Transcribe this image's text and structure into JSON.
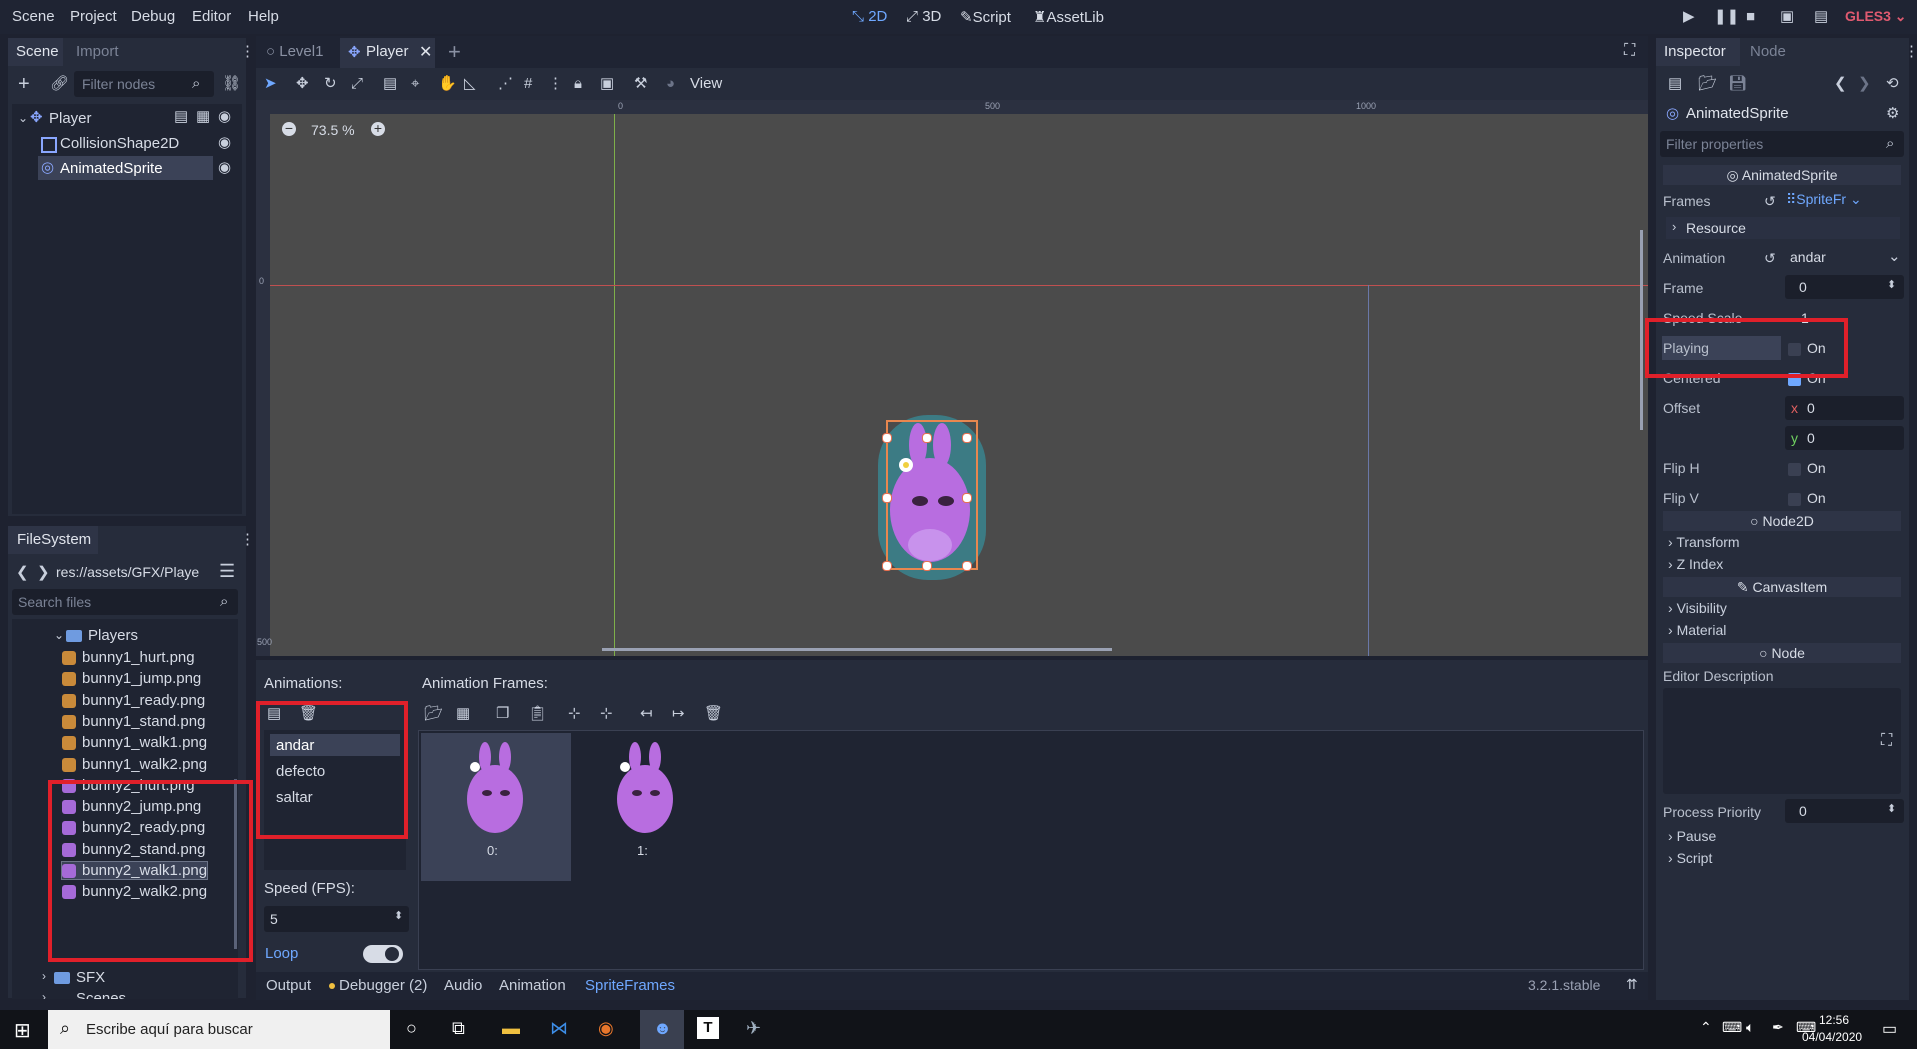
{
  "menu": {
    "scene": "Scene",
    "project": "Project",
    "debug": "Debug",
    "editor": "Editor",
    "help": "Help"
  },
  "modes": {
    "m2d": "2D",
    "m3d": "3D",
    "script": "Script",
    "assetlib": "AssetLib"
  },
  "renderer": "GLES3",
  "left_dock": {
    "tabs": {
      "scene": "Scene",
      "import": "Import"
    },
    "filter_placeholder": "Filter nodes",
    "tree": [
      {
        "label": "Player"
      },
      {
        "label": "CollisionShape2D"
      },
      {
        "label": "AnimatedSprite"
      }
    ]
  },
  "filesystem": {
    "title": "FileSystem",
    "path": "res://assets/GFX/Playe",
    "search_placeholder": "Search files",
    "folder": "Players",
    "files": [
      "bunny1_hurt.png",
      "bunny1_jump.png",
      "bunny1_ready.png",
      "bunny1_stand.png",
      "bunny1_walk1.png",
      "bunny1_walk2.png",
      "bunny2_hurt.png",
      "bunny2_jump.png",
      "bunny2_ready.png",
      "bunny2_stand.png",
      "bunny2_walk1.png",
      "bunny2_walk2.png"
    ],
    "sfx": "SFX",
    "scenes": "Scenes"
  },
  "editor_tabs": {
    "level1": "Level1",
    "player": "Player"
  },
  "toolbar": {
    "view": "View"
  },
  "viewport": {
    "zoom": "73.5 %",
    "ruler": {
      "r0": "0",
      "r500": "500",
      "r1000": "1000",
      "v0": "0",
      "v500": "500"
    }
  },
  "spriteframes": {
    "animations_title": "Animations:",
    "frames_title": "Animation Frames:",
    "animations": [
      "andar",
      "defecto",
      "saltar"
    ],
    "frames": [
      "0:",
      "1:"
    ],
    "speed_label": "Speed (FPS):",
    "speed_value": "5",
    "loop_label": "Loop"
  },
  "bottom_bar": {
    "output": "Output",
    "debugger": "Debugger (2)",
    "audio": "Audio",
    "animation": "Animation",
    "spriteframes": "SpriteFrames",
    "version": "3.2.1.stable"
  },
  "inspector": {
    "tabs": {
      "inspector": "Inspector",
      "node": "Node"
    },
    "object": "AnimatedSprite",
    "filter_placeholder": "Filter properties",
    "class_header": "AnimatedSprite",
    "frames_label": "Frames",
    "frames_value": "SpriteFr",
    "resource": "Resource",
    "animation_label": "Animation",
    "animation_value": "andar",
    "frame_label": "Frame",
    "frame_value": "0",
    "speed_label": "Speed Scale",
    "speed_value": "1",
    "playing_label": "Playing",
    "playing_value": "On",
    "centered_label": "Centered",
    "centered_value": "On",
    "offset_label": "Offset",
    "offset_x_axis": "x",
    "offset_x": "0",
    "offset_y_axis": "y",
    "offset_y": "0",
    "fliph_label": "Flip H",
    "fliph_value": "On",
    "flipv_label": "Flip V",
    "flipv_value": "On",
    "node2d": "Node2D",
    "transform": "Transform",
    "zindex": "Z Index",
    "canvasitem": "CanvasItem",
    "visibility": "Visibility",
    "material": "Material",
    "node": "Node",
    "editor_description": "Editor Description",
    "process_priority_label": "Process Priority",
    "process_priority_value": "0",
    "pause": "Pause",
    "script": "Script"
  },
  "taskbar": {
    "search": "Escribe aquí para buscar",
    "time": "12:56",
    "date": "04/04/2020"
  },
  "colors": {
    "accent": "#6fa8ff",
    "highlight": "#e0202a",
    "sprite": "#b86de0"
  }
}
